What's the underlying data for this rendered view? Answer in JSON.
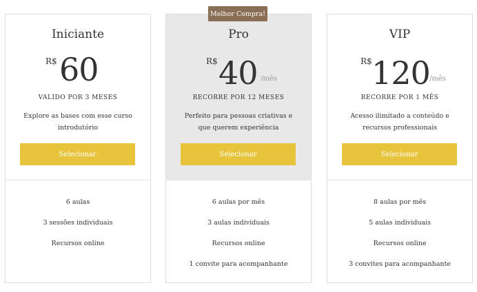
{
  "badge": "Melhor Compra!",
  "plans": [
    {
      "name": "Iniciante",
      "currency": "R$",
      "amount": "60",
      "period": "",
      "billing": "VALIDO POR 3 MESES",
      "description": "Explore as bases com esse curso introdutório",
      "button": "Selecionar",
      "features": [
        "6 aulas",
        "3 sessões individuais",
        "Recursos online"
      ]
    },
    {
      "name": "Pro",
      "currency": "R$",
      "amount": "40",
      "period": "/mês",
      "billing": "RECORRE POR 12 MESES",
      "description": "Perfeito para pessoas criativas e que querem experiência",
      "button": "Selecionar",
      "features": [
        "6 aulas por mês",
        "3 aulas individuais",
        "Recursos online",
        "1 convite para acompanhante"
      ]
    },
    {
      "name": "VIP",
      "currency": "R$",
      "amount": "120",
      "period": "/mês",
      "billing": "RECORRE POR 1 MÊS",
      "description": "Acesso ilimitado a conteúdo e recursos professionais",
      "button": "Selecionar",
      "features": [
        "8 aulas por mês",
        "5 aulas individuais",
        "Recursos online",
        "3 convites para acompanhante"
      ]
    }
  ],
  "colors": {
    "accent": "#e8c43c",
    "badge": "#8a6e56",
    "featured_bg": "#e8e8e8",
    "border": "#dddddd"
  }
}
